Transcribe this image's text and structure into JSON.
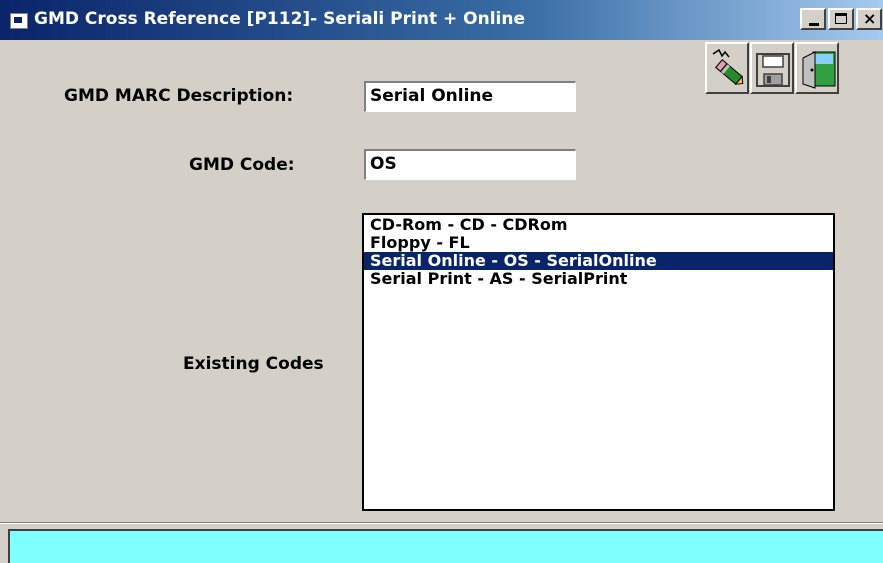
{
  "window": {
    "title": "GMD Cross Reference  [P112]- Seriali Print + Online"
  },
  "toolbar": {
    "buttons": [
      {
        "name": "edit",
        "icon": "eraser-pencil-icon"
      },
      {
        "name": "save",
        "icon": "floppy-disk-icon"
      },
      {
        "name": "exit",
        "icon": "exit-door-icon"
      }
    ]
  },
  "form": {
    "description_label": "GMD MARC Description:",
    "description_value": "Serial Online",
    "code_label": "GMD Code:",
    "code_value": "OS",
    "existing_label": "Existing Codes"
  },
  "list": {
    "items": [
      "CD-Rom - CD - CDRom",
      "Floppy - FL",
      "Serial Online - OS - SerialOnline",
      "Serial Print - AS - SerialPrint"
    ],
    "selected_index": 2
  },
  "colors": {
    "title_bar": "#0a246a",
    "window_face": "#d4d0c8",
    "selection": "#0a246a",
    "status_panel": "#80ffff"
  }
}
